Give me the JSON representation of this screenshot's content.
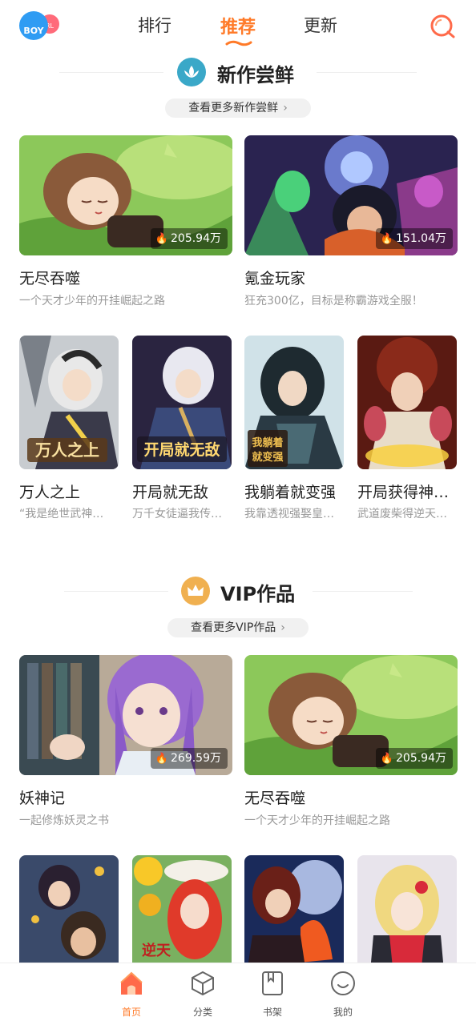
{
  "header": {
    "boy_label": "BOY",
    "girl_label": "RL",
    "tabs": [
      {
        "label": "排行",
        "active": false
      },
      {
        "label": "推荐",
        "active": true
      },
      {
        "label": "更新",
        "active": false
      }
    ],
    "search_icon": "search-icon",
    "accent": "#ff7a28"
  },
  "section_new": {
    "title": "新作尝鲜",
    "more": "查看更多新作尝鲜",
    "icon": "lotus-icon",
    "icon_color": "#3aa8c8"
  },
  "new_large": [
    {
      "title": "无尽吞噬",
      "desc": "一个天才少年的开挂崛起之路",
      "heat": "205.94万"
    },
    {
      "title": "氪金玩家",
      "desc": "狂充300亿，目标是称霸游戏全服！",
      "heat": "151.04万"
    }
  ],
  "new_small": [
    {
      "title": "万人之上",
      "desc": "“我是绝世武神…"
    },
    {
      "title": "开局就无敌",
      "desc": "万千女徒逼我传…"
    },
    {
      "title": "我躺着就变强",
      "desc": "我靠透视强娶皇…"
    },
    {
      "title": "开局获得神…",
      "desc": "武道废柴得逆天…"
    }
  ],
  "section_vip": {
    "title": "VIP作品",
    "more": "查看更多VIP作品",
    "icon": "crown-icon",
    "icon_color": "#f0b050"
  },
  "vip_large": [
    {
      "title": "妖神记",
      "desc": "一起修炼妖灵之书",
      "heat": "269.59万"
    },
    {
      "title": "无尽吞噬",
      "desc": "一个天才少年的开挂崛起之路",
      "heat": "205.94万"
    }
  ],
  "bottom_nav": [
    {
      "label": "首页",
      "icon": "home-icon",
      "active": true
    },
    {
      "label": "分类",
      "icon": "category-cube-icon",
      "active": false
    },
    {
      "label": "书架",
      "icon": "bookshelf-icon",
      "active": false
    },
    {
      "label": "我的",
      "icon": "profile-smile-icon",
      "active": false
    }
  ]
}
